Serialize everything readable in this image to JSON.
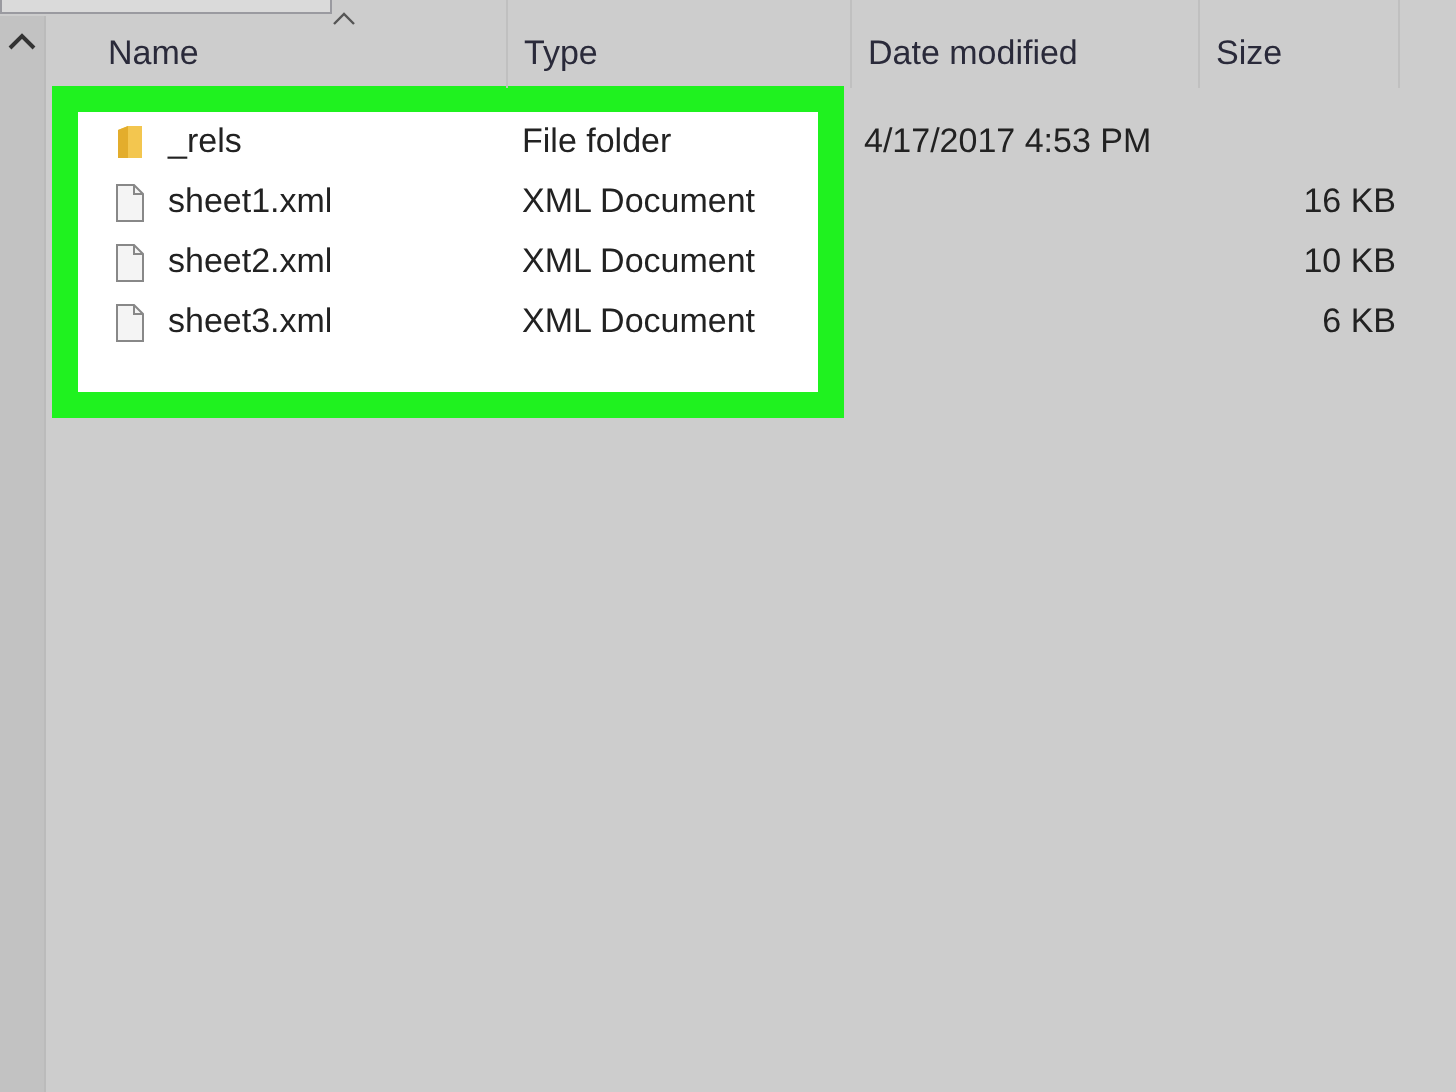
{
  "columns": [
    {
      "label": "Name",
      "sorted": true
    },
    {
      "label": "Type",
      "sorted": false
    },
    {
      "label": "Date modified",
      "sorted": false
    },
    {
      "label": "Size",
      "sorted": false
    }
  ],
  "rows": [
    {
      "kind": "folder",
      "name": "_rels",
      "type": "File folder",
      "date": "4/17/2017 4:53 PM"
    },
    {
      "kind": "file",
      "name": "sheet1.xml",
      "type": "XML Document",
      "size": "16 KB"
    },
    {
      "kind": "file",
      "name": "sheet2.xml",
      "type": "XML Document",
      "size": "10 KB"
    },
    {
      "kind": "file",
      "name": "sheet3.xml",
      "type": "XML Document",
      "size": "6 KB"
    }
  ]
}
